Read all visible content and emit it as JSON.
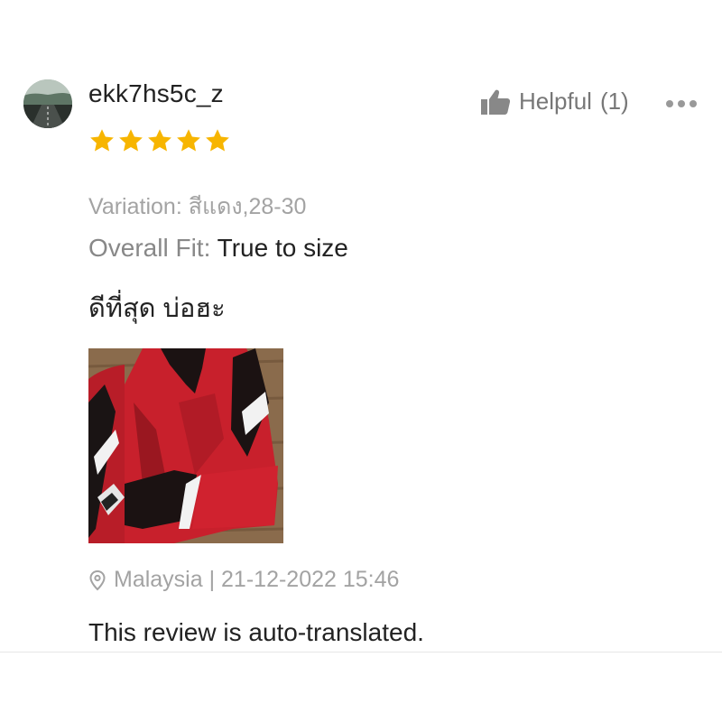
{
  "review": {
    "username": "ekk7hs5c_z",
    "rating": 5,
    "rating_max": 5,
    "helpful_label": "Helpful",
    "helpful_count": "(1)",
    "variation": "Variation: สีแดง,28-30",
    "fit_label": "Overall Fit:",
    "fit_value": "True to size",
    "comment": "ดีที่สุด บ่อฮะ",
    "location_text": "Malaysia | 21-12-2022 15:46",
    "translation_note": "This review is auto-translated."
  },
  "icons": {
    "helpful": "thumbs-up-icon",
    "more": "more-dots-icon",
    "location": "location-pin-icon",
    "star": "star-icon"
  },
  "colors": {
    "star": "#F7B500",
    "muted_text": "#A3A3A3",
    "helpful_text": "#777777",
    "primary_text": "#222222"
  }
}
